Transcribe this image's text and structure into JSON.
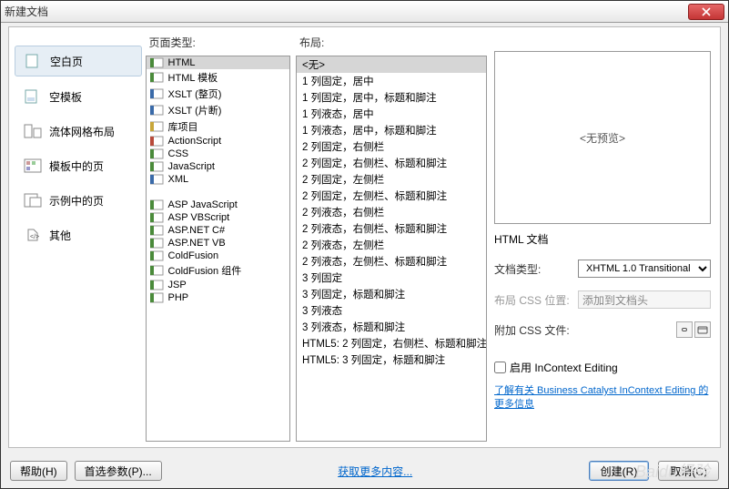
{
  "title": "新建文档",
  "categories": [
    {
      "id": "blank",
      "label": "空白页"
    },
    {
      "id": "blanktpl",
      "label": "空模板"
    },
    {
      "id": "fluid",
      "label": "流体网格布局"
    },
    {
      "id": "tplpage",
      "label": "模板中的页"
    },
    {
      "id": "samplepage",
      "label": "示例中的页"
    },
    {
      "id": "other",
      "label": "其他"
    }
  ],
  "columns": {
    "pagetype": "页面类型:",
    "layout": "布局:"
  },
  "page_types": [
    {
      "label": "HTML",
      "icon": "green"
    },
    {
      "label": "HTML 模板",
      "icon": "green"
    },
    {
      "label": "XSLT (整页)",
      "icon": "blue"
    },
    {
      "label": "XSLT (片断)",
      "icon": "blue"
    },
    {
      "label": "库项目",
      "icon": "yellow"
    },
    {
      "label": "ActionScript",
      "icon": "red"
    },
    {
      "label": "CSS",
      "icon": "green"
    },
    {
      "label": "JavaScript",
      "icon": "green"
    },
    {
      "label": "XML",
      "icon": "blue"
    },
    {
      "gap": true
    },
    {
      "label": "ASP JavaScript",
      "icon": "green"
    },
    {
      "label": "ASP VBScript",
      "icon": "green"
    },
    {
      "label": "ASP.NET C#",
      "icon": "green"
    },
    {
      "label": "ASP.NET VB",
      "icon": "green"
    },
    {
      "label": "ColdFusion",
      "icon": "green"
    },
    {
      "label": "ColdFusion 组件",
      "icon": "green"
    },
    {
      "label": "JSP",
      "icon": "green"
    },
    {
      "label": "PHP",
      "icon": "green"
    }
  ],
  "layouts": [
    "<无>",
    "1 列固定，居中",
    "1 列固定，居中，标题和脚注",
    "1 列液态，居中",
    "1 列液态，居中，标题和脚注",
    "2 列固定，右侧栏",
    "2 列固定，右侧栏、标题和脚注",
    "2 列固定，左侧栏",
    "2 列固定，左侧栏、标题和脚注",
    "2 列液态，右侧栏",
    "2 列液态，右侧栏、标题和脚注",
    "2 列液态，左侧栏",
    "2 列液态，左侧栏、标题和脚注",
    "3 列固定",
    "3 列固定，标题和脚注",
    "3 列液态",
    "3 列液态，标题和脚注",
    "HTML5: 2 列固定，右侧栏、标题和脚注",
    "HTML5: 3 列固定，标题和脚注"
  ],
  "preview": {
    "no_preview": "<无预览>",
    "doc_label": "HTML 文档"
  },
  "form": {
    "doctype_label": "文档类型:",
    "doctype_value": "XHTML 1.0 Transitional",
    "css_pos_label": "布局 CSS 位置:",
    "css_pos_value": "添加到文档头",
    "attach_css_label": "附加 CSS 文件:",
    "incontext_label": "启用 InContext Editing",
    "incontext_link": "了解有关 Business Catalyst InContext Editing 的更多信息"
  },
  "footer": {
    "help": "帮助(H)",
    "prefs": "首选参数(P)...",
    "more_link": "获取更多内容...",
    "create": "创建(R)",
    "cancel": "取消(C)"
  }
}
